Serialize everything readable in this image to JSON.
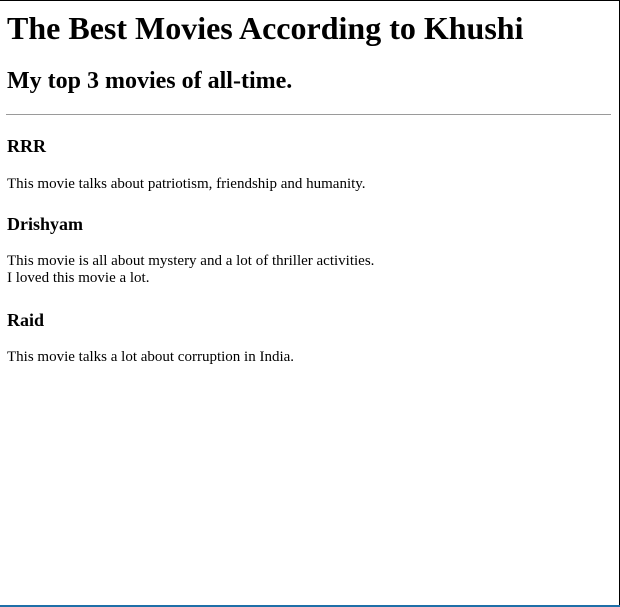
{
  "page": {
    "title": "The Best Movies According to Khushi",
    "subtitle": "My top 3 movies of all-time."
  },
  "movies": [
    {
      "title": "RRR",
      "description_lines": [
        "This movie talks about patriotism, friendship and humanity."
      ]
    },
    {
      "title": "Drishyam",
      "description_lines": [
        "This movie is all about mystery and a lot of thriller activities.",
        "I loved this movie a lot."
      ]
    },
    {
      "title": "Raid",
      "description_lines": [
        "This movie talks a lot about corruption in India."
      ]
    }
  ],
  "colors": {
    "text": "#000000",
    "divider": "#9a9a9a",
    "bottom_bar": "#1f6fa8"
  }
}
